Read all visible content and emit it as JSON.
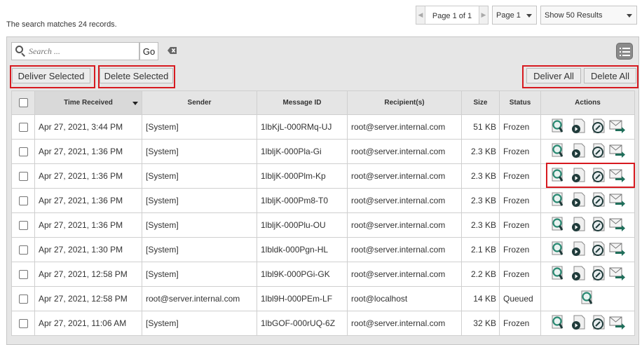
{
  "summary": "The search matches 24 records.",
  "pager": {
    "label": "Page 1 of 1"
  },
  "page_select": {
    "value": "Page 1"
  },
  "results_select": {
    "value": "Show 50 Results"
  },
  "search": {
    "placeholder": "Search ...",
    "go_label": "Go"
  },
  "buttons": {
    "deliver_selected": "Deliver Selected",
    "delete_selected": "Delete Selected",
    "deliver_all": "Deliver All",
    "delete_all": "Delete All"
  },
  "colors": {
    "highlight": "#d71a20",
    "icon_teal": "#2a8a73",
    "icon_dark": "#1f3b3a"
  },
  "table": {
    "columns": [
      "Time Received",
      "Sender",
      "Message ID",
      "Recipient(s)",
      "Size",
      "Status",
      "Actions"
    ],
    "rows": [
      {
        "time": "Apr 27, 2021, 3:44 PM",
        "sender": "[System]",
        "msgid": "1lbKjL-000RMq-UJ",
        "recipient": "root@server.internal.com",
        "size": "51 KB",
        "status": "Frozen",
        "actions": [
          "view-icon",
          "deliver-icon",
          "history-icon",
          "mail-forward-icon"
        ]
      },
      {
        "time": "Apr 27, 2021, 1:36 PM",
        "sender": "[System]",
        "msgid": "1lbljK-000Pla-Gi",
        "recipient": "root@server.internal.com",
        "size": "2.3 KB",
        "status": "Frozen",
        "actions": [
          "view-icon",
          "deliver-icon",
          "history-icon",
          "mail-forward-icon"
        ]
      },
      {
        "time": "Apr 27, 2021, 1:36 PM",
        "sender": "[System]",
        "msgid": "1lbljK-000Plm-Kp",
        "recipient": "root@server.internal.com",
        "size": "2.3 KB",
        "status": "Frozen",
        "actions": [
          "view-icon",
          "deliver-icon",
          "history-icon",
          "mail-forward-icon"
        ]
      },
      {
        "time": "Apr 27, 2021, 1:36 PM",
        "sender": "[System]",
        "msgid": "1lbljK-000Pm8-T0",
        "recipient": "root@server.internal.com",
        "size": "2.3 KB",
        "status": "Frozen",
        "actions": [
          "view-icon",
          "deliver-icon",
          "history-icon",
          "mail-forward-icon"
        ]
      },
      {
        "time": "Apr 27, 2021, 1:36 PM",
        "sender": "[System]",
        "msgid": "1lbljK-000Plu-OU",
        "recipient": "root@server.internal.com",
        "size": "2.3 KB",
        "status": "Frozen",
        "actions": [
          "view-icon",
          "deliver-icon",
          "history-icon",
          "mail-forward-icon"
        ]
      },
      {
        "time": "Apr 27, 2021, 1:30 PM",
        "sender": "[System]",
        "msgid": "1lbldk-000Pgn-HL",
        "recipient": "root@server.internal.com",
        "size": "2.1 KB",
        "status": "Frozen",
        "actions": [
          "view-icon",
          "deliver-icon",
          "history-icon",
          "mail-forward-icon"
        ]
      },
      {
        "time": "Apr 27, 2021, 12:58 PM",
        "sender": "[System]",
        "msgid": "1lbl9K-000PGi-GK",
        "recipient": "root@server.internal.com",
        "size": "2.2 KB",
        "status": "Frozen",
        "actions": [
          "view-icon",
          "deliver-icon",
          "history-icon",
          "mail-forward-icon"
        ]
      },
      {
        "time": "Apr 27, 2021, 12:58 PM",
        "sender": "root@server.internal.com",
        "msgid": "1lbl9H-000PEm-LF",
        "recipient": "root@localhost",
        "size": "14 KB",
        "status": "Queued",
        "actions": [
          "view-icon"
        ]
      },
      {
        "time": "Apr 27, 2021, 11:06 AM",
        "sender": "[System]",
        "msgid": "1lbGOF-000rUQ-6Z",
        "recipient": "root@server.internal.com",
        "size": "32 KB",
        "status": "Frozen",
        "actions": [
          "view-icon",
          "deliver-icon",
          "history-icon",
          "mail-forward-icon"
        ]
      }
    ]
  }
}
